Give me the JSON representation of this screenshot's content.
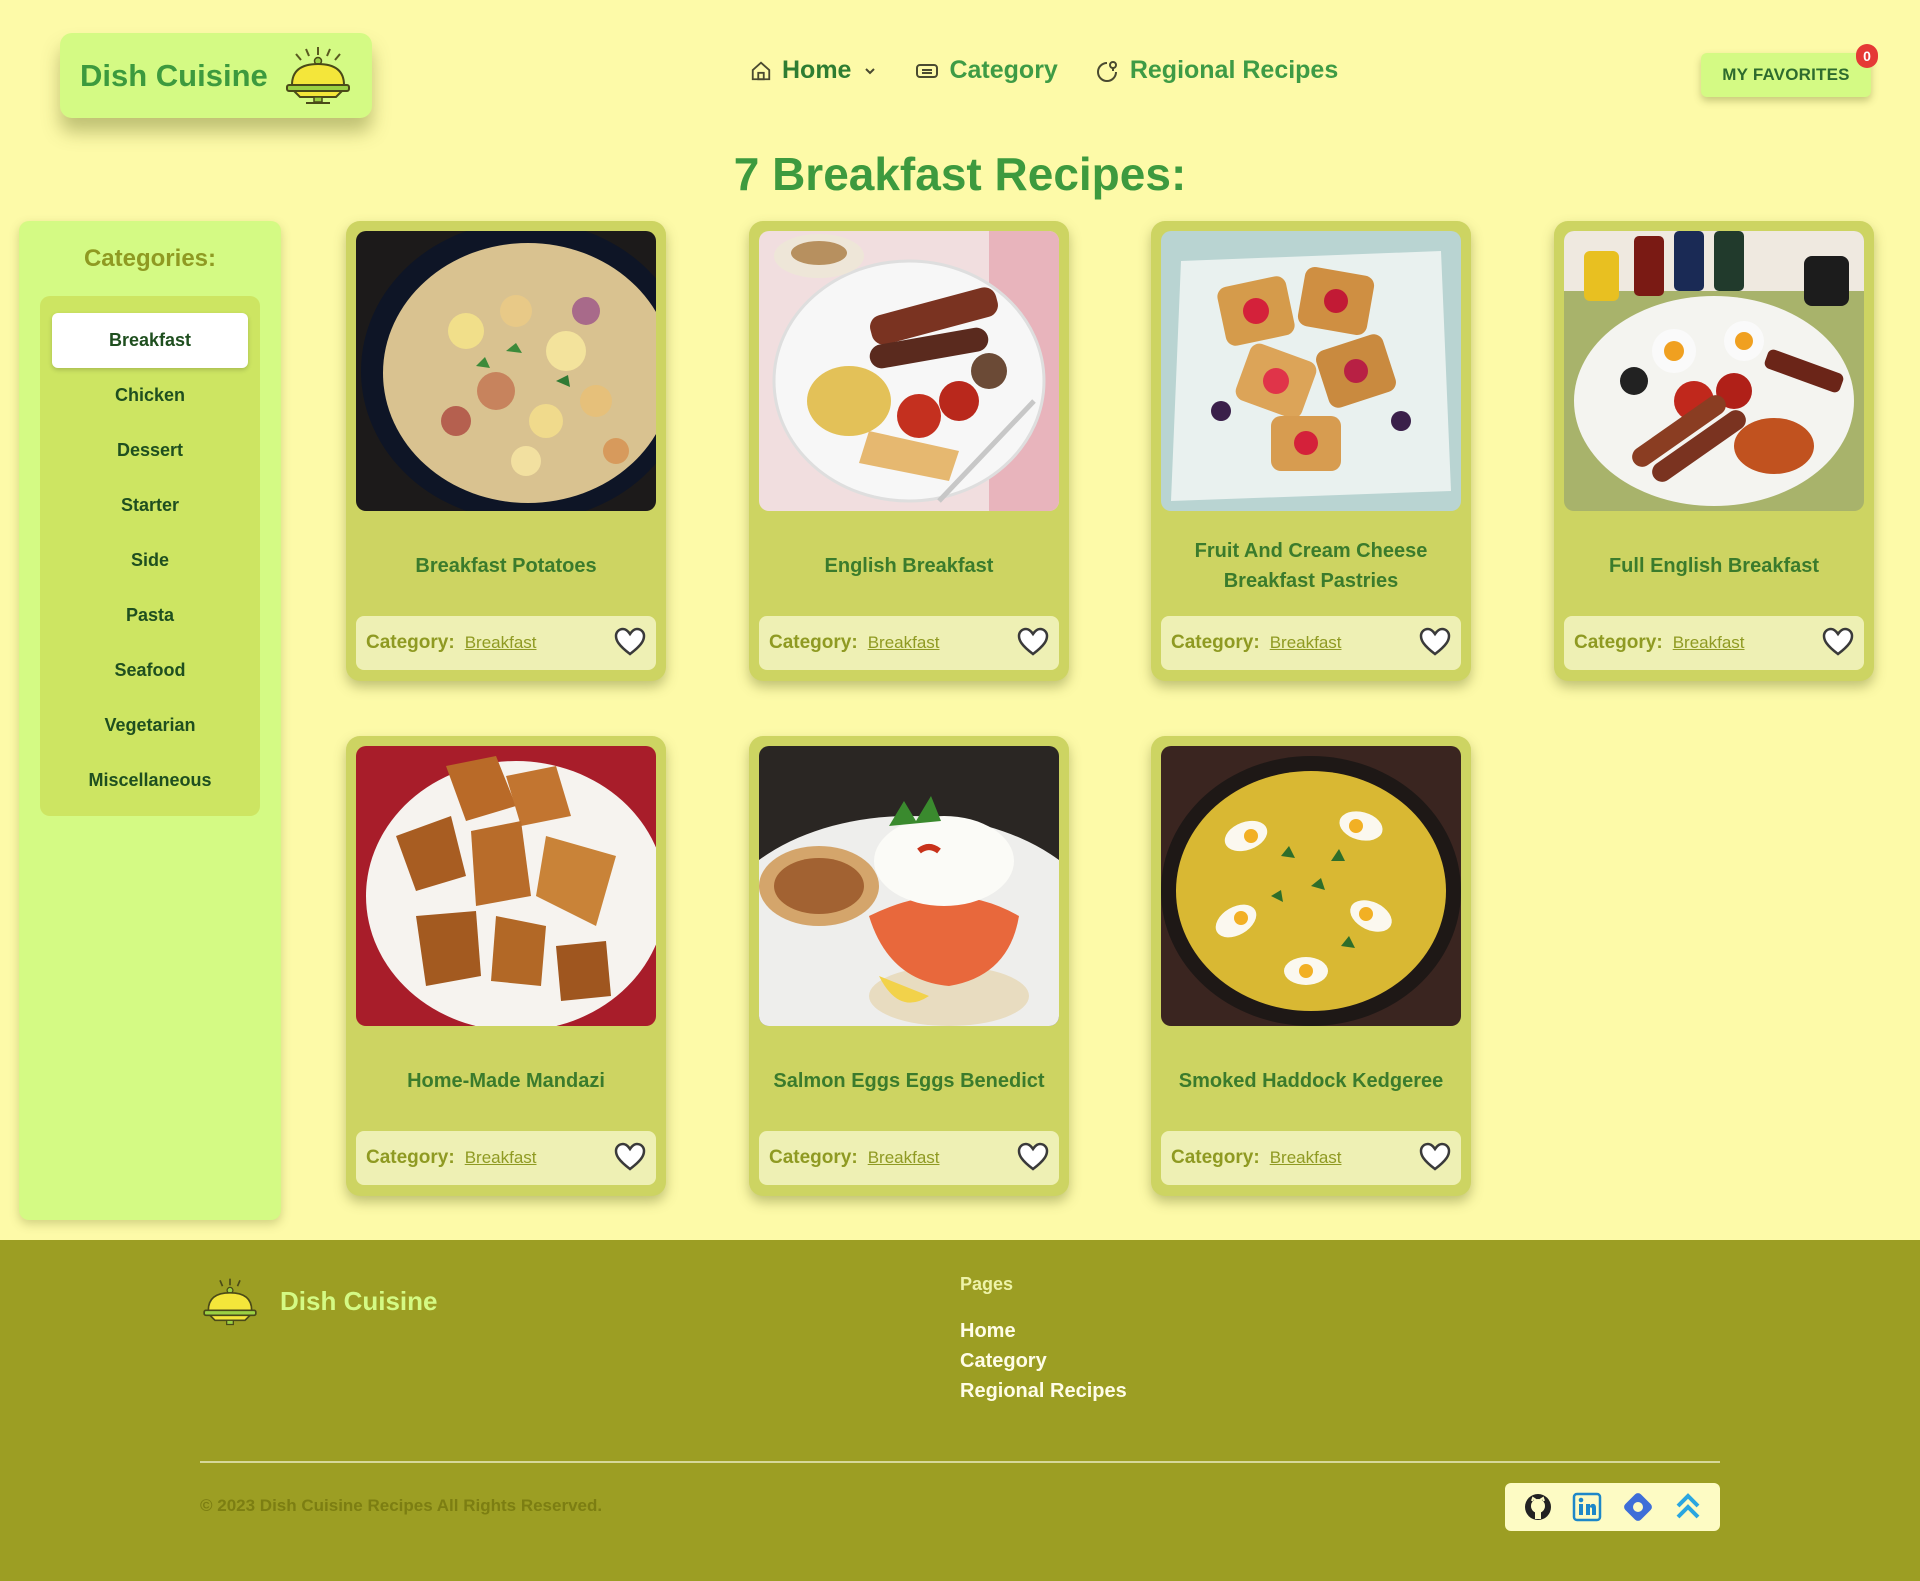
{
  "header": {
    "brand": "Dish Cuisine",
    "nav": [
      {
        "label": "Home"
      },
      {
        "label": "Category"
      },
      {
        "label": "Regional Recipes"
      }
    ],
    "favorites_label": "MY FAVORITES",
    "favorites_count": "0"
  },
  "page_heading": "7 Breakfast Recipes:",
  "sidebar": {
    "title": "Categories:",
    "items": [
      "Breakfast",
      "Chicken",
      "Dessert",
      "Starter",
      "Side",
      "Pasta",
      "Seafood",
      "Vegetarian",
      "Miscellaneous"
    ],
    "active": "Breakfast"
  },
  "recipes": [
    {
      "title": "Breakfast Potatoes",
      "category_label": "Category:",
      "category": "Breakfast",
      "image_icon": "potatoes-skillet-photo"
    },
    {
      "title": "English Breakfast",
      "category_label": "Category:",
      "category": "Breakfast",
      "image_icon": "english-breakfast-plate-photo"
    },
    {
      "title": "Fruit And Cream Cheese Breakfast Pastries",
      "category_label": "Category:",
      "category": "Breakfast",
      "image_icon": "fruit-pastries-photo"
    },
    {
      "title": "Full English Breakfast",
      "category_label": "Category:",
      "category": "Breakfast",
      "image_icon": "full-english-plate-photo"
    },
    {
      "title": "Home-Made Mandazi",
      "category_label": "Category:",
      "category": "Breakfast",
      "image_icon": "mandazi-photo"
    },
    {
      "title": "Salmon Eggs Eggs Benedict",
      "category_label": "Category:",
      "category": "Breakfast",
      "image_icon": "salmon-benedict-photo"
    },
    {
      "title": "Smoked Haddock Kedgeree",
      "category_label": "Category:",
      "category": "Breakfast",
      "image_icon": "kedgeree-pan-photo"
    }
  ],
  "footer": {
    "brand": "Dish Cuisine",
    "pages_heading": "Pages",
    "pages": [
      "Home",
      "Category",
      "Regional Recipes"
    ],
    "copyright": "© 2023 Dish Cuisine Recipes All Rights Reserved.",
    "social_icons": [
      "github-icon",
      "linkedin-icon",
      "portfolio-icon",
      "scroll-top-icon"
    ]
  },
  "colors": {
    "page_bg": "#fdfaa8",
    "accent_green": "#3d9a3e",
    "card_bg": "#cdd462",
    "sidebar_bg": "#d4fa84",
    "footer_bg": "#9c9e23",
    "badge": "#e53935"
  }
}
